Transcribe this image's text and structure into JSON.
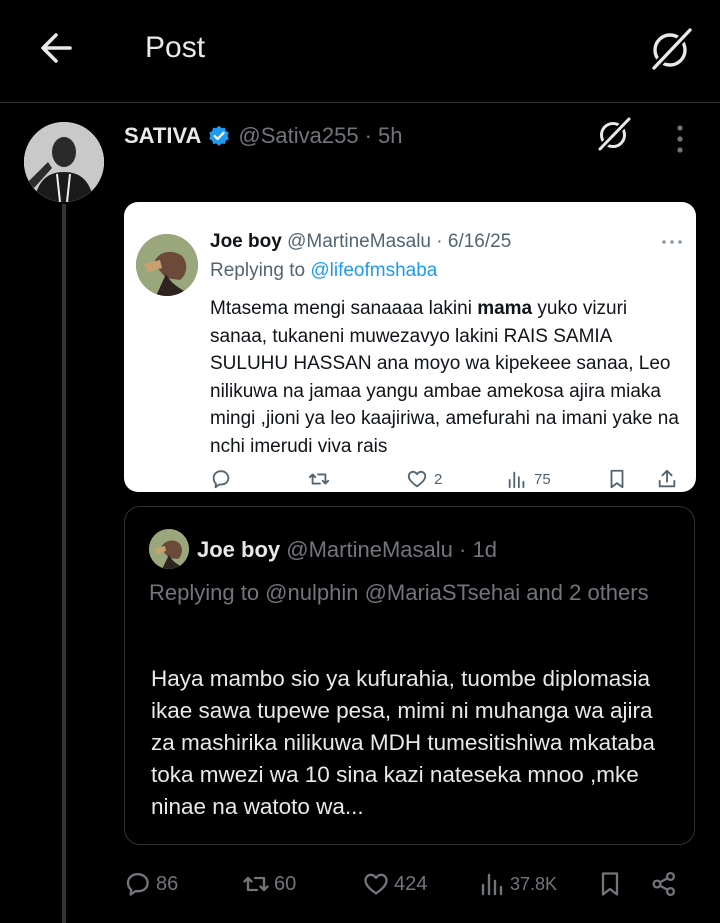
{
  "header": {
    "title": "Post"
  },
  "post": {
    "author_name": "SATIVA",
    "author_handle": "@Sativa255",
    "time": "· 5h",
    "stats": {
      "replies": "86",
      "reposts": "60",
      "likes": "424",
      "views": "37.8K"
    }
  },
  "screenshot_image": {
    "author_name": "Joe boy",
    "author_handle": "@MartineMasalu",
    "date": "· 6/16/25",
    "replying_prefix": "Replying to ",
    "replying_to": "@lifeofmshaba",
    "body_part1": "Mtasema mengi sanaaaa lakini ",
    "body_bold": "mama",
    "body_part2": " yuko vizuri sanaa, tukaneni muwezavyo lakini RAIS SAMIA SULUHU HASSAN ana moyo wa kipekeee sanaa, Leo nilikuwa na jamaa yangu ambae amekosa ajira miaka mingi ,jioni ya leo kaajiriwa, amefurahi na imani yake na nchi imerudi viva rais",
    "likes": "2",
    "views": "75"
  },
  "quoted_post": {
    "author_name": "Joe boy",
    "author_handle": "@MartineMasalu",
    "time": "· 1d",
    "replying_line": "Replying to @nulphin @MariaSTsehai and 2 others",
    "body": "Haya mambo sio ya kufurahia, tuombe diplomasia ikae sawa tupewe pesa, mimi ni muhanga wa ajira za mashirika nilikuwa MDH tumesitishiwa mkataba toka mwezi wa 10 sina kazi nateseka mnoo ,mke ninae na watoto wa..."
  },
  "colors": {
    "background": "#000000",
    "text": "#e7e9ea",
    "muted": "#71767b",
    "accent": "#1d9bf0",
    "border": "#2f3336"
  },
  "icons": [
    "back-arrow-icon",
    "grok-icon",
    "verified-badge-icon",
    "more-icon",
    "reply-icon",
    "repost-icon",
    "like-icon",
    "views-icon",
    "bookmark-icon",
    "share-icon"
  ]
}
